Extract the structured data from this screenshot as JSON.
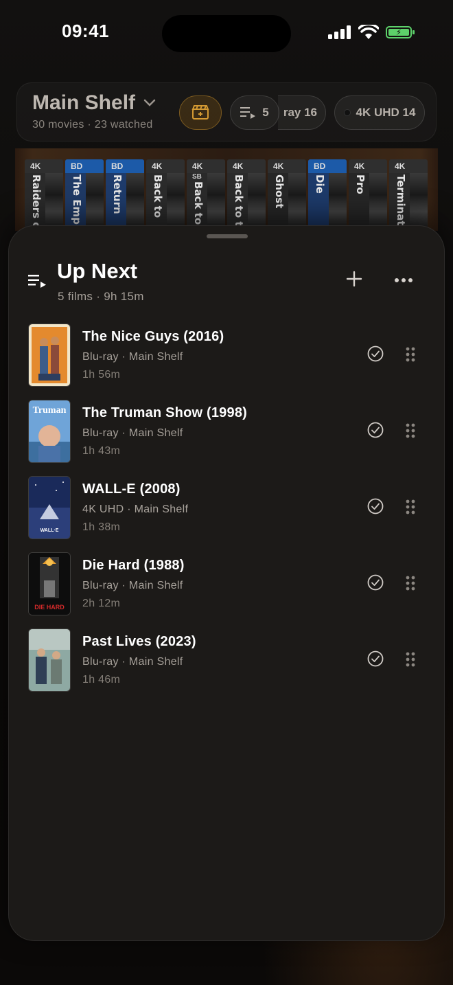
{
  "status_bar": {
    "time": "09:41"
  },
  "shelf_header": {
    "title": "Main Shelf",
    "subtitle": "30 movies · 23 watched",
    "queue_count": "5",
    "bluray_pill": "ray 16",
    "uhd_pill": "4K UHD 14"
  },
  "shelf_spines": [
    {
      "format": "4K",
      "title": "Raiders of",
      "color": "#2a2a2a"
    },
    {
      "format": "BD",
      "title": "The Empire",
      "color": "#1f3a66"
    },
    {
      "format": "BD",
      "title": "Return",
      "color": "#1e3b6b"
    },
    {
      "format": "4K",
      "title": "Back to",
      "color": "#2b2b2b"
    },
    {
      "format": "4K",
      "sb": "SB",
      "title": "Back to",
      "color": "#2a2a2a"
    },
    {
      "format": "4K",
      "title": "Back to th",
      "color": "#2b2b2b"
    },
    {
      "format": "4K",
      "title": "Ghost",
      "color": "#262626"
    },
    {
      "format": "BD",
      "title": "Die",
      "color": "#1d3a6a"
    },
    {
      "format": "4K",
      "title": "Pro",
      "color": "#262626"
    },
    {
      "format": "4K",
      "title": "Terminator",
      "color": "#2a2a2a"
    }
  ],
  "sheet": {
    "title": "Up Next",
    "subtitle": "5 films · 9h 15m",
    "icons": {
      "queue": "queue-icon",
      "add": "plus-icon",
      "more": "ellipsis-icon"
    }
  },
  "queue": [
    {
      "title": "The Nice Guys (2016)",
      "meta": "Blu-ray · Main Shelf",
      "duration": "1h 56m",
      "poster": "nice-guys"
    },
    {
      "title": "The Truman Show (1998)",
      "meta": "Blu-ray · Main Shelf",
      "duration": "1h 43m",
      "poster": "truman"
    },
    {
      "title": "WALL-E (2008)",
      "meta": "4K UHD · Main Shelf",
      "duration": "1h 38m",
      "poster": "walle"
    },
    {
      "title": "Die Hard (1988)",
      "meta": "Blu-ray · Main Shelf",
      "duration": "2h 12m",
      "poster": "diehard"
    },
    {
      "title": "Past Lives (2023)",
      "meta": "Blu-ray · Main Shelf",
      "duration": "1h 46m",
      "poster": "pastlives"
    }
  ],
  "poster_text": {
    "truman": "Truman",
    "walle": "WALL·E",
    "diehard": "DIE HARD"
  },
  "colors": {
    "accent_gold": "#d49a33",
    "battery_green": "#5dd16a",
    "sheet_bg": "#1c1a18"
  }
}
